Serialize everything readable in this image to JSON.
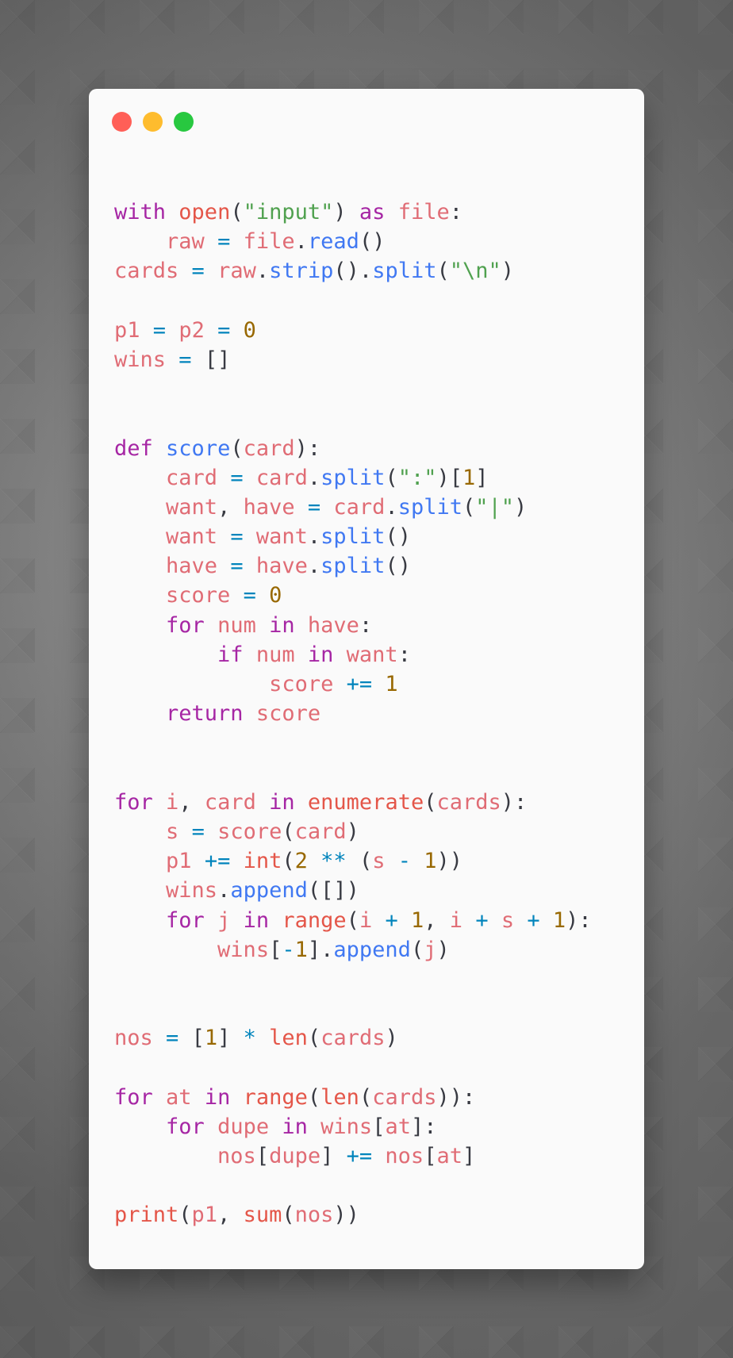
{
  "window": {
    "controls": [
      {
        "name": "close",
        "color": "#ff5f57"
      },
      {
        "name": "minimize",
        "color": "#febc2e"
      },
      {
        "name": "maximize",
        "color": "#28c840"
      }
    ]
  },
  "theme": {
    "keyword": "#a626a4",
    "variable": "#e06c75",
    "function": "#4078f2",
    "builtin": "#e45649",
    "string": "#50a14f",
    "number": "#986801",
    "operator": "#0184bc",
    "punctuation": "#383a42"
  },
  "code": {
    "language": "python",
    "lines": [
      [
        [
          "kw",
          "with"
        ],
        [
          "p",
          " "
        ],
        [
          "b",
          "open"
        ],
        [
          "p",
          "("
        ],
        [
          "s",
          "\"input\""
        ],
        [
          "p",
          ")"
        ],
        [
          "p",
          " "
        ],
        [
          "kw",
          "as"
        ],
        [
          "p",
          " "
        ],
        [
          "v",
          "file"
        ],
        [
          "p",
          ":"
        ]
      ],
      [
        [
          "p",
          "    "
        ],
        [
          "v",
          "raw"
        ],
        [
          "p",
          " "
        ],
        [
          "o",
          "="
        ],
        [
          "p",
          " "
        ],
        [
          "v",
          "file"
        ],
        [
          "p",
          "."
        ],
        [
          "f",
          "read"
        ],
        [
          "p",
          "()"
        ]
      ],
      [
        [
          "v",
          "cards"
        ],
        [
          "p",
          " "
        ],
        [
          "o",
          "="
        ],
        [
          "p",
          " "
        ],
        [
          "v",
          "raw"
        ],
        [
          "p",
          "."
        ],
        [
          "f",
          "strip"
        ],
        [
          "p",
          "()."
        ],
        [
          "f",
          "split"
        ],
        [
          "p",
          "("
        ],
        [
          "s",
          "\"\\n\""
        ],
        [
          "p",
          ")"
        ]
      ],
      [],
      [
        [
          "v",
          "p1"
        ],
        [
          "p",
          " "
        ],
        [
          "o",
          "="
        ],
        [
          "p",
          " "
        ],
        [
          "v",
          "p2"
        ],
        [
          "p",
          " "
        ],
        [
          "o",
          "="
        ],
        [
          "p",
          " "
        ],
        [
          "n",
          "0"
        ]
      ],
      [
        [
          "v",
          "wins"
        ],
        [
          "p",
          " "
        ],
        [
          "o",
          "="
        ],
        [
          "p",
          " []"
        ]
      ],
      [],
      [],
      [
        [
          "kw",
          "def"
        ],
        [
          "p",
          " "
        ],
        [
          "f",
          "score"
        ],
        [
          "p",
          "("
        ],
        [
          "v",
          "card"
        ],
        [
          "p",
          "):"
        ]
      ],
      [
        [
          "p",
          "    "
        ],
        [
          "v",
          "card"
        ],
        [
          "p",
          " "
        ],
        [
          "o",
          "="
        ],
        [
          "p",
          " "
        ],
        [
          "v",
          "card"
        ],
        [
          "p",
          "."
        ],
        [
          "f",
          "split"
        ],
        [
          "p",
          "("
        ],
        [
          "s",
          "\":\""
        ],
        [
          "p",
          ")["
        ],
        [
          "n",
          "1"
        ],
        [
          "p",
          "]"
        ]
      ],
      [
        [
          "p",
          "    "
        ],
        [
          "v",
          "want"
        ],
        [
          "p",
          ", "
        ],
        [
          "v",
          "have"
        ],
        [
          "p",
          " "
        ],
        [
          "o",
          "="
        ],
        [
          "p",
          " "
        ],
        [
          "v",
          "card"
        ],
        [
          "p",
          "."
        ],
        [
          "f",
          "split"
        ],
        [
          "p",
          "("
        ],
        [
          "s",
          "\"|\""
        ],
        [
          "p",
          ")"
        ]
      ],
      [
        [
          "p",
          "    "
        ],
        [
          "v",
          "want"
        ],
        [
          "p",
          " "
        ],
        [
          "o",
          "="
        ],
        [
          "p",
          " "
        ],
        [
          "v",
          "want"
        ],
        [
          "p",
          "."
        ],
        [
          "f",
          "split"
        ],
        [
          "p",
          "()"
        ]
      ],
      [
        [
          "p",
          "    "
        ],
        [
          "v",
          "have"
        ],
        [
          "p",
          " "
        ],
        [
          "o",
          "="
        ],
        [
          "p",
          " "
        ],
        [
          "v",
          "have"
        ],
        [
          "p",
          "."
        ],
        [
          "f",
          "split"
        ],
        [
          "p",
          "()"
        ]
      ],
      [
        [
          "p",
          "    "
        ],
        [
          "v",
          "score"
        ],
        [
          "p",
          " "
        ],
        [
          "o",
          "="
        ],
        [
          "p",
          " "
        ],
        [
          "n",
          "0"
        ]
      ],
      [
        [
          "p",
          "    "
        ],
        [
          "kw",
          "for"
        ],
        [
          "p",
          " "
        ],
        [
          "v",
          "num"
        ],
        [
          "p",
          " "
        ],
        [
          "kw",
          "in"
        ],
        [
          "p",
          " "
        ],
        [
          "v",
          "have"
        ],
        [
          "p",
          ":"
        ]
      ],
      [
        [
          "p",
          "        "
        ],
        [
          "kw",
          "if"
        ],
        [
          "p",
          " "
        ],
        [
          "v",
          "num"
        ],
        [
          "p",
          " "
        ],
        [
          "kw",
          "in"
        ],
        [
          "p",
          " "
        ],
        [
          "v",
          "want"
        ],
        [
          "p",
          ":"
        ]
      ],
      [
        [
          "p",
          "            "
        ],
        [
          "v",
          "score"
        ],
        [
          "p",
          " "
        ],
        [
          "o",
          "+="
        ],
        [
          "p",
          " "
        ],
        [
          "n",
          "1"
        ]
      ],
      [
        [
          "p",
          "    "
        ],
        [
          "kw",
          "return"
        ],
        [
          "p",
          " "
        ],
        [
          "v",
          "score"
        ]
      ],
      [],
      [],
      [
        [
          "kw",
          "for"
        ],
        [
          "p",
          " "
        ],
        [
          "v",
          "i"
        ],
        [
          "p",
          ", "
        ],
        [
          "v",
          "card"
        ],
        [
          "p",
          " "
        ],
        [
          "kw",
          "in"
        ],
        [
          "p",
          " "
        ],
        [
          "b",
          "enumerate"
        ],
        [
          "p",
          "("
        ],
        [
          "v",
          "cards"
        ],
        [
          "p",
          "):"
        ]
      ],
      [
        [
          "p",
          "    "
        ],
        [
          "v",
          "s"
        ],
        [
          "p",
          " "
        ],
        [
          "o",
          "="
        ],
        [
          "p",
          " "
        ],
        [
          "v",
          "score"
        ],
        [
          "p",
          "("
        ],
        [
          "v",
          "card"
        ],
        [
          "p",
          ")"
        ]
      ],
      [
        [
          "p",
          "    "
        ],
        [
          "v",
          "p1"
        ],
        [
          "p",
          " "
        ],
        [
          "o",
          "+="
        ],
        [
          "p",
          " "
        ],
        [
          "b",
          "int"
        ],
        [
          "p",
          "("
        ],
        [
          "n",
          "2"
        ],
        [
          "p",
          " "
        ],
        [
          "o",
          "**"
        ],
        [
          "p",
          " ("
        ],
        [
          "v",
          "s"
        ],
        [
          "p",
          " "
        ],
        [
          "o",
          "-"
        ],
        [
          "p",
          " "
        ],
        [
          "n",
          "1"
        ],
        [
          "p",
          "))"
        ]
      ],
      [
        [
          "p",
          "    "
        ],
        [
          "v",
          "wins"
        ],
        [
          "p",
          "."
        ],
        [
          "f",
          "append"
        ],
        [
          "p",
          "([])"
        ]
      ],
      [
        [
          "p",
          "    "
        ],
        [
          "kw",
          "for"
        ],
        [
          "p",
          " "
        ],
        [
          "v",
          "j"
        ],
        [
          "p",
          " "
        ],
        [
          "kw",
          "in"
        ],
        [
          "p",
          " "
        ],
        [
          "b",
          "range"
        ],
        [
          "p",
          "("
        ],
        [
          "v",
          "i"
        ],
        [
          "p",
          " "
        ],
        [
          "o",
          "+"
        ],
        [
          "p",
          " "
        ],
        [
          "n",
          "1"
        ],
        [
          "p",
          ", "
        ],
        [
          "v",
          "i"
        ],
        [
          "p",
          " "
        ],
        [
          "o",
          "+"
        ],
        [
          "p",
          " "
        ],
        [
          "v",
          "s"
        ],
        [
          "p",
          " "
        ],
        [
          "o",
          "+"
        ],
        [
          "p",
          " "
        ],
        [
          "n",
          "1"
        ],
        [
          "p",
          "):"
        ]
      ],
      [
        [
          "p",
          "        "
        ],
        [
          "v",
          "wins"
        ],
        [
          "p",
          "["
        ],
        [
          "o",
          "-"
        ],
        [
          "n",
          "1"
        ],
        [
          "p",
          "]."
        ],
        [
          "f",
          "append"
        ],
        [
          "p",
          "("
        ],
        [
          "v",
          "j"
        ],
        [
          "p",
          ")"
        ]
      ],
      [],
      [],
      [
        [
          "v",
          "nos"
        ],
        [
          "p",
          " "
        ],
        [
          "o",
          "="
        ],
        [
          "p",
          " ["
        ],
        [
          "n",
          "1"
        ],
        [
          "p",
          "] "
        ],
        [
          "o",
          "*"
        ],
        [
          "p",
          " "
        ],
        [
          "b",
          "len"
        ],
        [
          "p",
          "("
        ],
        [
          "v",
          "cards"
        ],
        [
          "p",
          ")"
        ]
      ],
      [],
      [
        [
          "kw",
          "for"
        ],
        [
          "p",
          " "
        ],
        [
          "v",
          "at"
        ],
        [
          "p",
          " "
        ],
        [
          "kw",
          "in"
        ],
        [
          "p",
          " "
        ],
        [
          "b",
          "range"
        ],
        [
          "p",
          "("
        ],
        [
          "b",
          "len"
        ],
        [
          "p",
          "("
        ],
        [
          "v",
          "cards"
        ],
        [
          "p",
          "))"
        ],
        [
          "p",
          ":"
        ]
      ],
      [
        [
          "p",
          "    "
        ],
        [
          "kw",
          "for"
        ],
        [
          "p",
          " "
        ],
        [
          "v",
          "dupe"
        ],
        [
          "p",
          " "
        ],
        [
          "kw",
          "in"
        ],
        [
          "p",
          " "
        ],
        [
          "v",
          "wins"
        ],
        [
          "p",
          "["
        ],
        [
          "v",
          "at"
        ],
        [
          "p",
          "]:"
        ]
      ],
      [
        [
          "p",
          "        "
        ],
        [
          "v",
          "nos"
        ],
        [
          "p",
          "["
        ],
        [
          "v",
          "dupe"
        ],
        [
          "p",
          "] "
        ],
        [
          "o",
          "+="
        ],
        [
          "p",
          " "
        ],
        [
          "v",
          "nos"
        ],
        [
          "p",
          "["
        ],
        [
          "v",
          "at"
        ],
        [
          "p",
          "]"
        ]
      ],
      [],
      [
        [
          "b",
          "print"
        ],
        [
          "p",
          "("
        ],
        [
          "v",
          "p1"
        ],
        [
          "p",
          ", "
        ],
        [
          "b",
          "sum"
        ],
        [
          "p",
          "("
        ],
        [
          "v",
          "nos"
        ],
        [
          "p",
          "))"
        ]
      ]
    ]
  }
}
